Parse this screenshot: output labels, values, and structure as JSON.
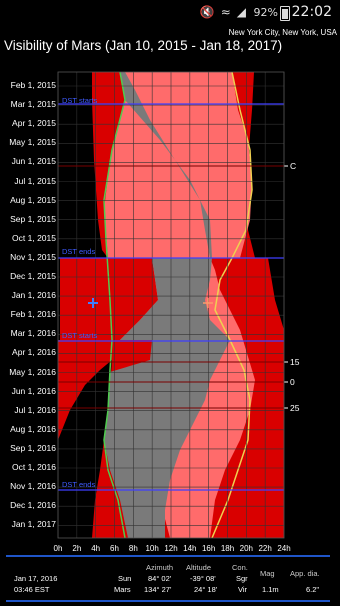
{
  "status": {
    "battery": "92%",
    "time": "22:02",
    "icons": [
      "mute-icon",
      "wifi-icon",
      "signal-icon"
    ]
  },
  "location": "New York City, New York, USA",
  "title": "Visibility of Mars (Jan 10, 2015 - Jan 18, 2017)",
  "chart_data": {
    "type": "area",
    "y_labels": [
      "Feb 1, 2015",
      "Mar 1, 2015",
      "Apr 1, 2015",
      "May 1, 2015",
      "Jun 1, 2015",
      "Jul 1, 2015",
      "Aug 1, 2015",
      "Sep 1, 2015",
      "Oct 1, 2015",
      "Nov 1, 2015",
      "Dec 1, 2015",
      "Jan 1, 2016",
      "Feb 1, 2016",
      "Mar 1, 2016",
      "Apr 1, 2016",
      "May 1, 2016",
      "Jun 1, 2016",
      "Jul 1, 2016",
      "Aug 1, 2016",
      "Sep 1, 2016",
      "Oct 1, 2016",
      "Nov 1, 2016",
      "Dec 1, 2016",
      "Jan 1, 2017"
    ],
    "x_labels": [
      "0h",
      "2h",
      "4h",
      "6h",
      "8h",
      "10h",
      "12h",
      "14h",
      "16h",
      "18h",
      "20h",
      "22h",
      "24h"
    ],
    "right_labels": [
      "C",
      "15",
      "0",
      "25"
    ],
    "dst_labels": [
      "DST starts",
      "DST ends",
      "DST starts",
      "DST ends"
    ],
    "colors": {
      "day": "#d90000",
      "twilight": "#ff5a5a",
      "mars_up": "#7a7a7a",
      "mars_up_dark": "#f08a8a",
      "rise_line": "#4fcc4f",
      "set_line": "#f0d050",
      "dst_line": "#3f3fff"
    }
  },
  "info": {
    "date": "Jan 17, 2016",
    "time": "03:46 EST",
    "headers": [
      "Azimuth",
      "Altitude",
      "Con.",
      "Mag",
      "App. dia."
    ],
    "rows": [
      {
        "body": "Sun",
        "azimuth": "84° 02'",
        "altitude": "-39° 08'",
        "con": "Sgr",
        "mag": "",
        "dia": ""
      },
      {
        "body": "Mars",
        "azimuth": "134° 27'",
        "altitude": "24° 18'",
        "con": "Vir",
        "mag": "1.1m",
        "dia": "6.2\""
      }
    ]
  }
}
